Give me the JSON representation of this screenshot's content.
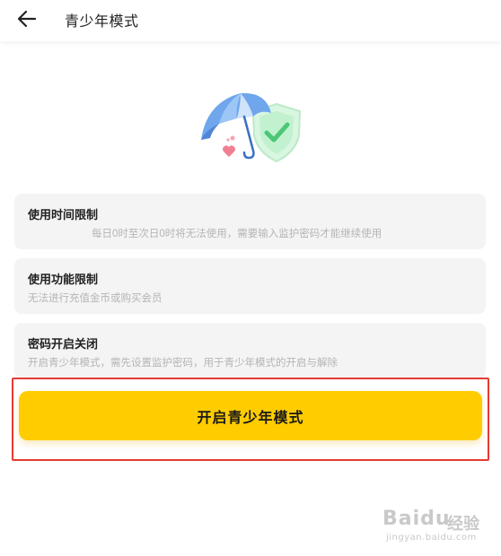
{
  "header": {
    "title": "青少年模式",
    "back_icon": "arrow-left-icon"
  },
  "hero": {
    "icon": "umbrella-shield-illustration",
    "colors": {
      "umbrella": "#6fa6ec",
      "shield": "#bdf0cc",
      "check": "#4cc777",
      "heart": "#f07f94"
    }
  },
  "cards": [
    {
      "title": "使用时间限制",
      "description": "每日0时至次日0时将无法使用，需要输入监护密码才能继续使用"
    },
    {
      "title": "使用功能限制",
      "description": "无法进行充值金币或购买会员"
    },
    {
      "title": "密码开启关闭",
      "description": "开启青少年模式，需先设置监护密码，用于青少年模式的开启与解除"
    }
  ],
  "cta": {
    "label": "开启青少年模式",
    "color": "#ffcc00"
  },
  "annotation": {
    "color": "#e53a32"
  },
  "watermark": {
    "logo": "Baidu",
    "cn": "经验",
    "url": "jingyan.baidu.com"
  }
}
